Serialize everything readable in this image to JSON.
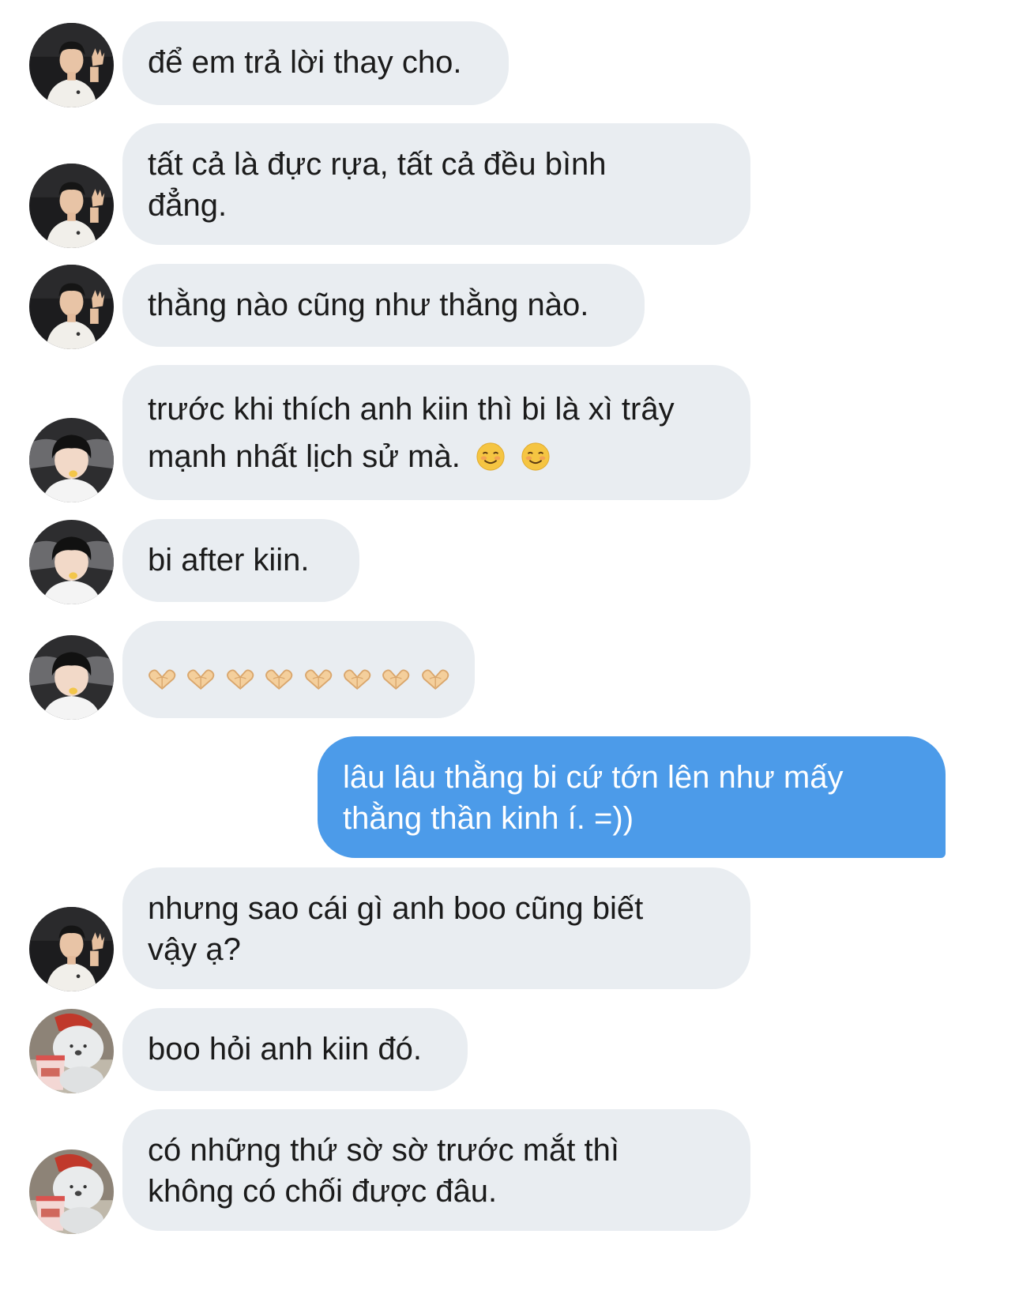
{
  "colors": {
    "received_bubble": "#e9edf1",
    "sent_bubble": "#4c9be9",
    "received_text": "#1b1b1b",
    "sent_text": "#ffffff"
  },
  "participants": {
    "kiin": {
      "avatar_icon": "user-avatar-man-white-shirt-icon"
    },
    "bi": {
      "avatar_icon": "user-avatar-boy-dark-hair-icon"
    },
    "boo": {
      "avatar_icon": "user-avatar-bear-cartoon-icon"
    }
  },
  "messages": [
    {
      "sender": "kiin",
      "lines": [
        "để em trả lời thay cho."
      ]
    },
    {
      "sender": "kiin",
      "lines": [
        "tất cả là đực rựa, tất cả đều bình",
        "đẳng."
      ]
    },
    {
      "sender": "kiin",
      "lines": [
        "thằng nào cũng như thằng nào."
      ]
    },
    {
      "sender": "bi",
      "lines": [
        "trước khi thích anh kiin thì bi là xì trây",
        "mạnh nhất lịch sử mà."
      ],
      "trailing_emoji": [
        "smiling-face-icon",
        "smiling-face-icon"
      ]
    },
    {
      "sender": "bi",
      "lines": [
        "bi after kiin."
      ]
    },
    {
      "sender": "bi",
      "emoji_only": "heart-hands-icon",
      "emoji_count": 8
    },
    {
      "sender": "me",
      "lines": [
        "lâu lâu thằng bi cứ tớn lên như mấy",
        "thằng thần kinh í. =))"
      ]
    },
    {
      "sender": "kiin",
      "lines": [
        "nhưng sao cái gì anh boo cũng biết",
        "vậy ạ?"
      ]
    },
    {
      "sender": "boo",
      "lines": [
        "boo hỏi anh kiin đó."
      ]
    },
    {
      "sender": "boo",
      "lines": [
        "có những thứ sờ sờ trước mắt thì",
        "không có chối được đâu."
      ]
    }
  ]
}
